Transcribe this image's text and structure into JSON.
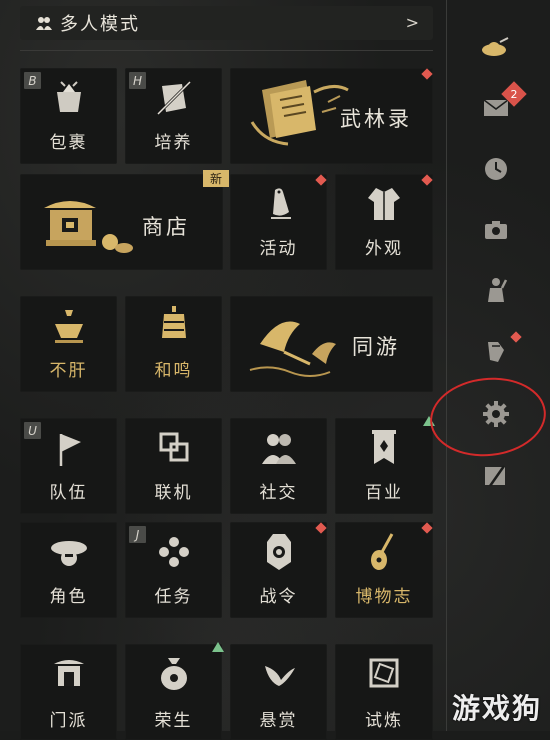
{
  "header": {
    "title": "多人模式",
    "chevron": ">"
  },
  "tiles": {
    "baoguo": {
      "label": "包裹",
      "key": "B"
    },
    "peiyang": {
      "label": "培养",
      "key": "H"
    },
    "wulinlu": {
      "label": "武林录"
    },
    "shangdian": {
      "label": "商店",
      "badge": "新"
    },
    "huodong": {
      "label": "活动"
    },
    "waiguan": {
      "label": "外观"
    },
    "bugan": {
      "label": "不肝"
    },
    "heming": {
      "label": "和鸣"
    },
    "tongyou": {
      "label": "同游"
    },
    "duiwu": {
      "label": "队伍",
      "key": "U"
    },
    "lianji": {
      "label": "联机"
    },
    "shejiao": {
      "label": "社交"
    },
    "baiye": {
      "label": "百业"
    },
    "juese": {
      "label": "角色"
    },
    "renwu": {
      "label": "任务",
      "key": "J"
    },
    "zhanling": {
      "label": "战令"
    },
    "bowuzhi": {
      "label": "博物志"
    },
    "row6_1": {
      "label": "门派"
    },
    "row6_2": {
      "label": "荣生"
    },
    "row6_3": {
      "label": "悬赏"
    },
    "row6_4": {
      "label": "试炼"
    }
  },
  "sidebar": {
    "mail_badge": "2",
    "icons": [
      "hat-icon",
      "mail-icon",
      "clock-icon",
      "camera-icon",
      "character-icon",
      "gesture-icon",
      "settings-icon",
      "exit-icon"
    ]
  },
  "watermark": "游戏狗",
  "colors": {
    "accent_gold": "#d8b76a",
    "red_dot": "#e25a50",
    "green_dot": "#7bc28c",
    "highlight_circle": "#d32a2a"
  }
}
